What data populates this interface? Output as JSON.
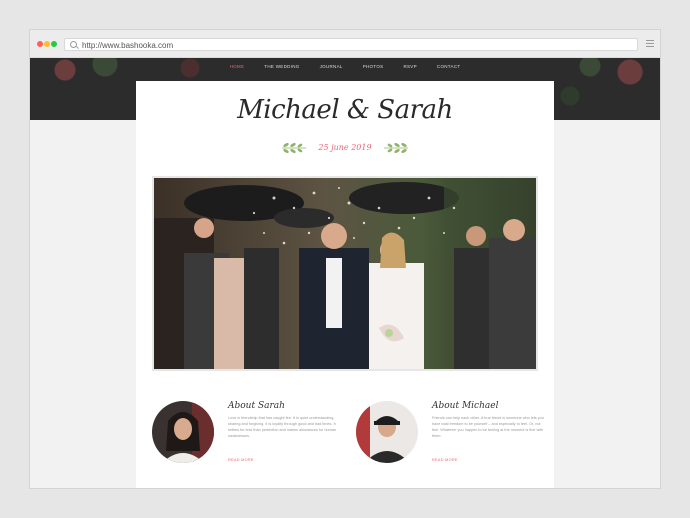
{
  "browser": {
    "url": "http://www.bashooka.com"
  },
  "nav": {
    "items": [
      "HOME",
      "THE WEDDING",
      "JOURNAL",
      "PHOTOS",
      "RSVP",
      "CONTACT"
    ],
    "active": "HOME"
  },
  "header": {
    "names": "Michael & Sarah",
    "date": "25 june 2019"
  },
  "about_sarah": {
    "title": "About Sarah",
    "text": "Love is friendship that has caught fire. It is quiet understanding, sharing and forgiving. It is loyalty through good and bad times. It settles for less than perfection and makes allowances for human weaknesses.",
    "link": "READ MORE"
  },
  "about_michael": {
    "title": "About Michael",
    "text": "Friends can help each other. A true friend is someone who lets you have total freedom to be yourself – and especially to feel. Or, not feel. Whatever you happen to be feeling at the moment is fine with them.",
    "link": "READ MORE"
  },
  "colors": {
    "accent": "#e4687a",
    "header_band": "#2c2c2c",
    "leaf": "#8fb36a"
  }
}
